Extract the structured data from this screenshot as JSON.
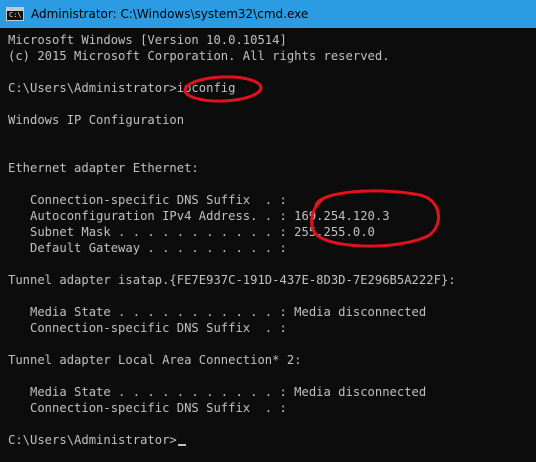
{
  "window": {
    "title": "Administrator: C:\\Windows\\system32\\cmd.exe",
    "icon": "command-prompt-icon",
    "icon_text": "C:\\"
  },
  "console": {
    "lines": [
      "Microsoft Windows [Version 10.0.10514]",
      "(c) 2015 Microsoft Corporation. All rights reserved.",
      "",
      "C:\\Users\\Administrator>ipconfig",
      "",
      "Windows IP Configuration",
      "",
      "",
      "Ethernet adapter Ethernet:",
      "",
      "   Connection-specific DNS Suffix  . :",
      "   Autoconfiguration IPv4 Address. . : 169.254.120.3",
      "   Subnet Mask . . . . . . . . . . . : 255.255.0.0",
      "   Default Gateway . . . . . . . . . :",
      "",
      "Tunnel adapter isatap.{FE7E937C-191D-437E-8D3D-7E296B5A222F}:",
      "",
      "   Media State . . . . . . . . . . . : Media disconnected",
      "   Connection-specific DNS Suffix  . :",
      "",
      "Tunnel adapter Local Area Connection* 2:",
      "",
      "   Media State . . . . . . . . . . . : Media disconnected",
      "   Connection-specific DNS Suffix  . :",
      "",
      "C:\\Users\\Administrator>"
    ]
  },
  "colors": {
    "titlebar": "#2b9ce3",
    "console_background": "#0c0c0c",
    "console_text": "#c0c0c0",
    "annotation": "#e0121c"
  }
}
